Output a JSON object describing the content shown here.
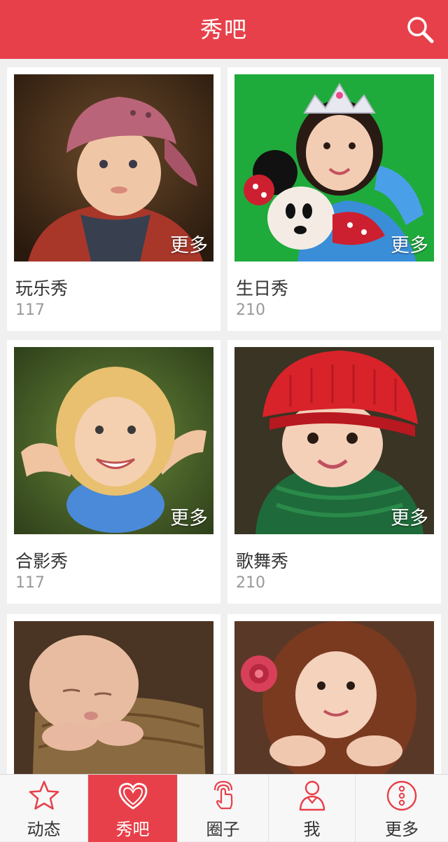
{
  "header": {
    "title": "秀吧",
    "search_icon": "search-icon"
  },
  "colors": {
    "accent": "#e8404a",
    "background": "#f0f0f0",
    "card": "#ffffff",
    "count_text": "#999999"
  },
  "categories": [
    {
      "name": "玩乐秀",
      "count": "117",
      "more_label": "更多"
    },
    {
      "name": "生日秀",
      "count": "210",
      "more_label": "更多"
    },
    {
      "name": "合影秀",
      "count": "117",
      "more_label": "更多"
    },
    {
      "name": "歌舞秀",
      "count": "210",
      "more_label": "更多"
    },
    {
      "name": "",
      "count": "",
      "more_label": ""
    },
    {
      "name": "",
      "count": "",
      "more_label": ""
    }
  ],
  "tabbar": {
    "active_index": 1,
    "items": [
      {
        "label": "动态",
        "icon": "star-icon"
      },
      {
        "label": "秀吧",
        "icon": "heart-icon"
      },
      {
        "label": "圈子",
        "icon": "touch-icon"
      },
      {
        "label": "我",
        "icon": "person-icon"
      },
      {
        "label": "更多",
        "icon": "more-dots-icon"
      }
    ]
  }
}
